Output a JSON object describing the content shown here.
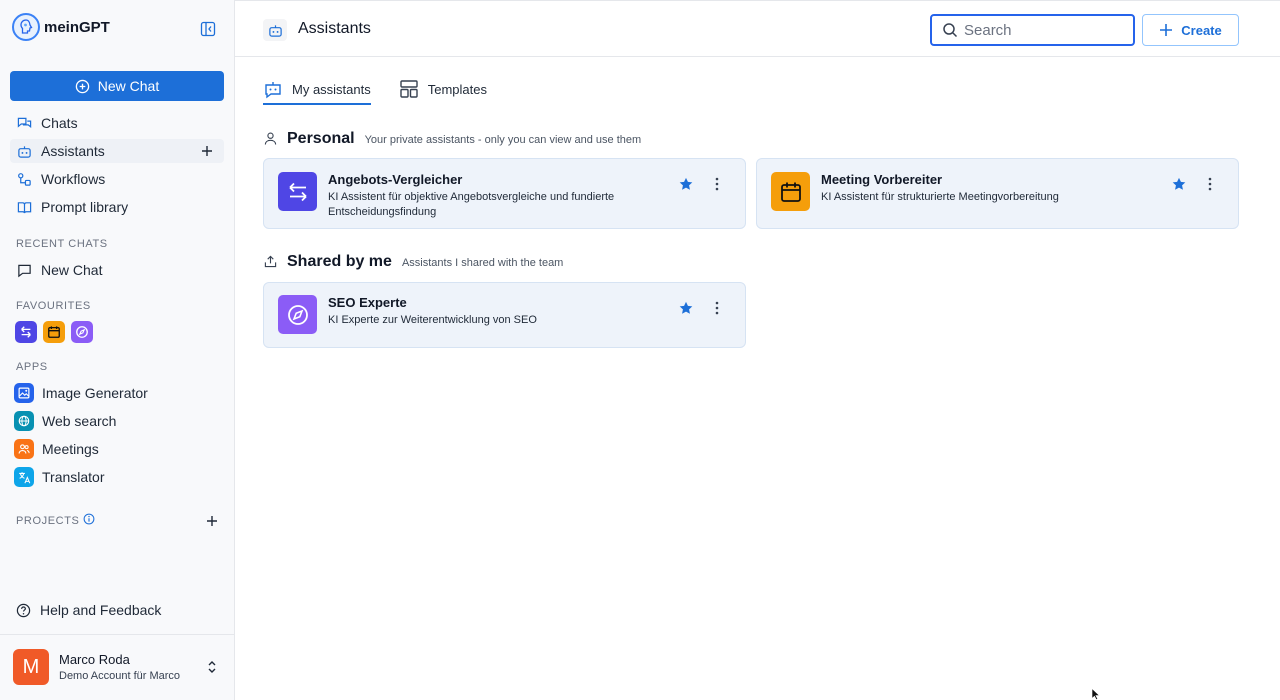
{
  "sidebar": {
    "brand": "meinGPT",
    "new_chat": "New Chat",
    "nav": [
      {
        "label": "Chats",
        "icon": "chats-icon"
      },
      {
        "label": "Assistants",
        "icon": "robot-icon"
      },
      {
        "label": "Workflows",
        "icon": "workflow-icon"
      },
      {
        "label": "Prompt library",
        "icon": "book-icon"
      }
    ],
    "recent_label": "RECENT CHATS",
    "recent": [
      {
        "label": "New Chat"
      }
    ],
    "favourites_label": "FAVOURITES",
    "favourites": [
      {
        "color": "#4f46e5",
        "icon": "arrows-icon"
      },
      {
        "color": "#f59e0b",
        "icon": "calendar-icon"
      },
      {
        "color": "#8b5cf6",
        "icon": "compass-icon"
      }
    ],
    "apps_label": "APPS",
    "apps": [
      {
        "label": "Image Generator",
        "color": "#2563eb",
        "icon": "image-icon"
      },
      {
        "label": "Web search",
        "color": "#0891b2",
        "icon": "globe-icon"
      },
      {
        "label": "Meetings",
        "color": "#f97316",
        "icon": "people-icon"
      },
      {
        "label": "Translator",
        "color": "#0ea5e9",
        "icon": "translate-icon"
      }
    ],
    "projects_label": "PROJECTS",
    "help": "Help and Feedback",
    "user": {
      "initial": "M",
      "name": "Marco Roda",
      "sub": "Demo Account für Marco"
    }
  },
  "header": {
    "title": "Assistants",
    "search_placeholder": "Search",
    "create": "Create"
  },
  "tabs": [
    {
      "label": "My assistants",
      "active": true
    },
    {
      "label": "Templates",
      "active": false
    }
  ],
  "sections": {
    "personal": {
      "title": "Personal",
      "subtitle": "Your private assistants - only you can view and use them",
      "cards": [
        {
          "title": "Angebots-Vergleicher",
          "desc": "KI Assistent für objektive Angebotsvergleiche und fundierte Entscheidungsfindung",
          "color": "#4f46e5"
        },
        {
          "title": "Meeting Vorbereiter",
          "desc": "KI Assistent für strukturierte Meetingvorbereitung",
          "color": "#f59e0b"
        }
      ]
    },
    "shared": {
      "title": "Shared by me",
      "subtitle": "Assistants I shared with the team",
      "cards": [
        {
          "title": "SEO Experte",
          "desc": "KI Experte zur Weiterentwicklung von SEO",
          "color": "#8b5cf6"
        }
      ]
    }
  },
  "colors": {
    "accent": "#1d6fd8",
    "star": "#1d6fd8"
  }
}
